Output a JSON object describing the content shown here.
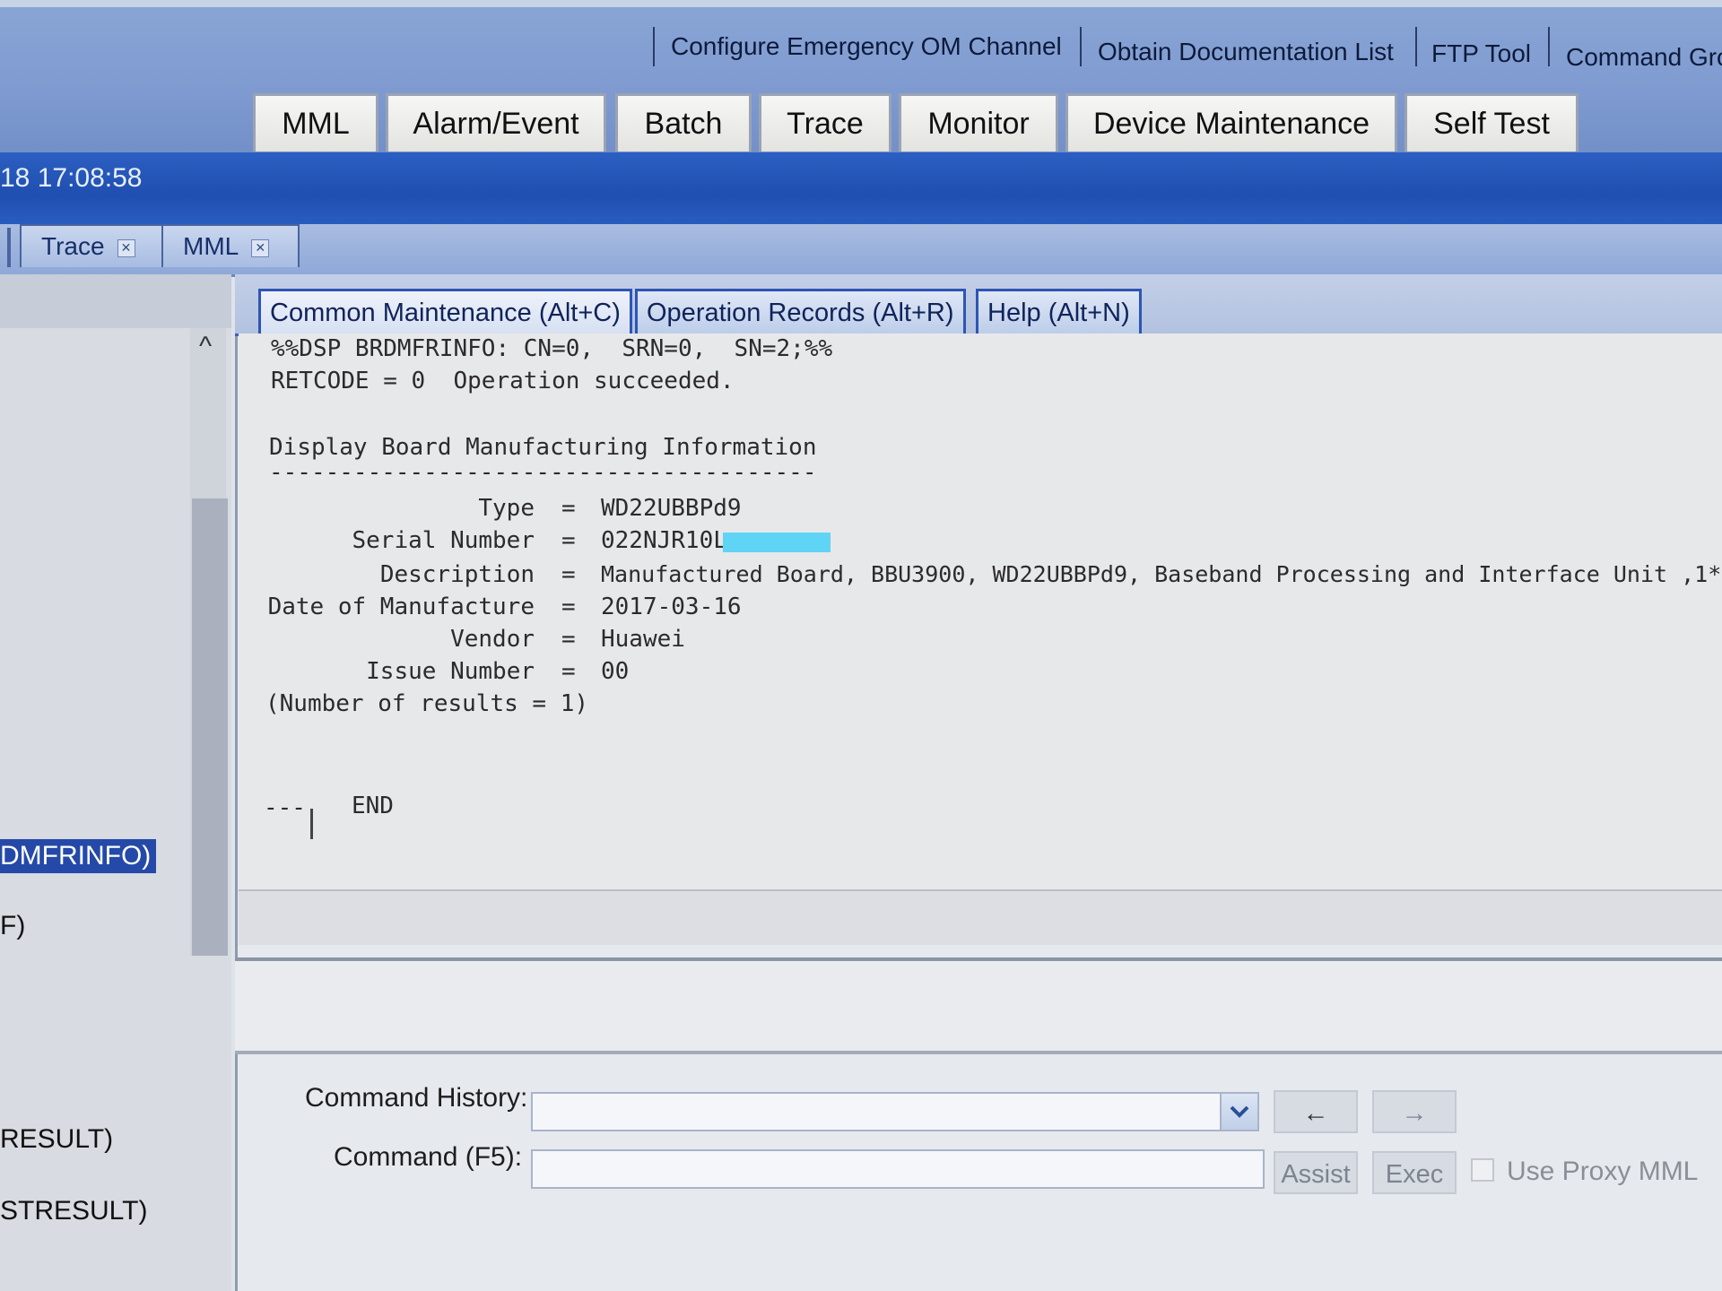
{
  "toolbar": {
    "links": [
      "Configure Emergency OM Channel",
      "Obtain Documentation List",
      "FTP Tool",
      "Command Gro"
    ]
  },
  "main_tabs": [
    "MML",
    "Alarm/Event",
    "Batch",
    "Trace",
    "Monitor",
    "Device Maintenance",
    "Self Test"
  ],
  "status": {
    "timestamp": "18 17:08:58"
  },
  "sub_tabs": [
    {
      "label": "Trace",
      "close": "✕"
    },
    {
      "label": "MML",
      "close": "✕"
    }
  ],
  "left_panel": {
    "scroll_up": "^",
    "items": [
      "DMFRINFO)",
      "F)",
      "RESULT)",
      "STRESULT)"
    ]
  },
  "content_tabs": [
    "Common Maintenance (Alt+C)",
    "Operation Records (Alt+R)",
    "Help (Alt+N)"
  ],
  "output": {
    "command_echo": "%%DSP BRDMFRINFO: CN=0,  SRN=0,  SN=2;%%",
    "retcode": "RETCODE = 0  Operation succeeded.",
    "section_title": "Display Board Manufacturing Information",
    "separator": "---------------------------------------",
    "fields": [
      {
        "key": "Type",
        "value": "WD22UBBPd9"
      },
      {
        "key": "Serial Number",
        "value": "022NJR10L"
      },
      {
        "key": "Description",
        "value": "Manufactured Board, BBU3900, WD22UBBPd9, Baseband Processing and Interface Unit ,1*"
      },
      {
        "key": "Date of Manufacture",
        "value": "2017-03-16"
      },
      {
        "key": "Vendor",
        "value": "Huawei"
      },
      {
        "key": "Issue Number",
        "value": "00"
      }
    ],
    "eq": "=",
    "count": "(Number of results = 1)",
    "end_dashes": "---",
    "end": "END"
  },
  "command_form": {
    "history_label": "Command History:",
    "history_value": "",
    "history_dropdown_icon": "chevron-down",
    "prev_label": "←",
    "next_label": "→",
    "command_label": "Command (F5):",
    "command_value": "",
    "assist_label": "Assist",
    "exec_label": "Exec",
    "proxy_label": "Use Proxy MML",
    "proxy_checked": false
  },
  "colors": {
    "status_bar": "#2a5cbf",
    "content_tab_border": "#2d55b4",
    "selection": "#2449a8",
    "redaction": "#5fd4f5"
  }
}
